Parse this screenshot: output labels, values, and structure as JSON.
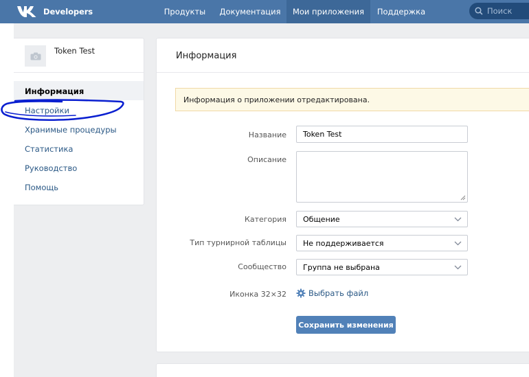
{
  "header": {
    "brand": "Developers",
    "nav": [
      "Продукты",
      "Документация",
      "Мои приложения",
      "Поддержка"
    ],
    "active_nav": "Мои приложения",
    "search_placeholder": "Поиск",
    "background_color": "#4a76a8",
    "active_color": "#3d6898"
  },
  "sidebar": {
    "app_name": "Token Test",
    "thumb_icon": "camera-icon",
    "items": [
      {
        "label": "Информация",
        "active": true
      },
      {
        "label": "Настройки",
        "active": false
      },
      {
        "label": "Хранимые процедуры",
        "active": false
      },
      {
        "label": "Статистика",
        "active": false
      },
      {
        "label": "Руководство",
        "active": false
      },
      {
        "label": "Помощь",
        "active": false
      }
    ],
    "annotation_color": "#0a1fd0"
  },
  "main": {
    "title": "Информация",
    "notice": "Информация о приложении отредактирована.",
    "form": {
      "name_label": "Название",
      "name_value": "Token Test",
      "description_label": "Описание",
      "description_value": "",
      "category_label": "Категория",
      "category_value": "Общение",
      "tournament_label": "Тип турнирной таблицы",
      "tournament_value": "Не поддерживается",
      "community_label": "Сообщество",
      "community_value": "Группа не выбрана",
      "icon_label": "Иконка 32×32",
      "choose_file": "Выбрать файл",
      "choose_file_icon": "gear-icon",
      "save_button": "Сохранить изменения"
    }
  },
  "colors": {
    "link": "#2a5885",
    "button": "#5181b8",
    "notice_bg": "#fdf9e6",
    "notice_border": "#f0d9a6"
  }
}
